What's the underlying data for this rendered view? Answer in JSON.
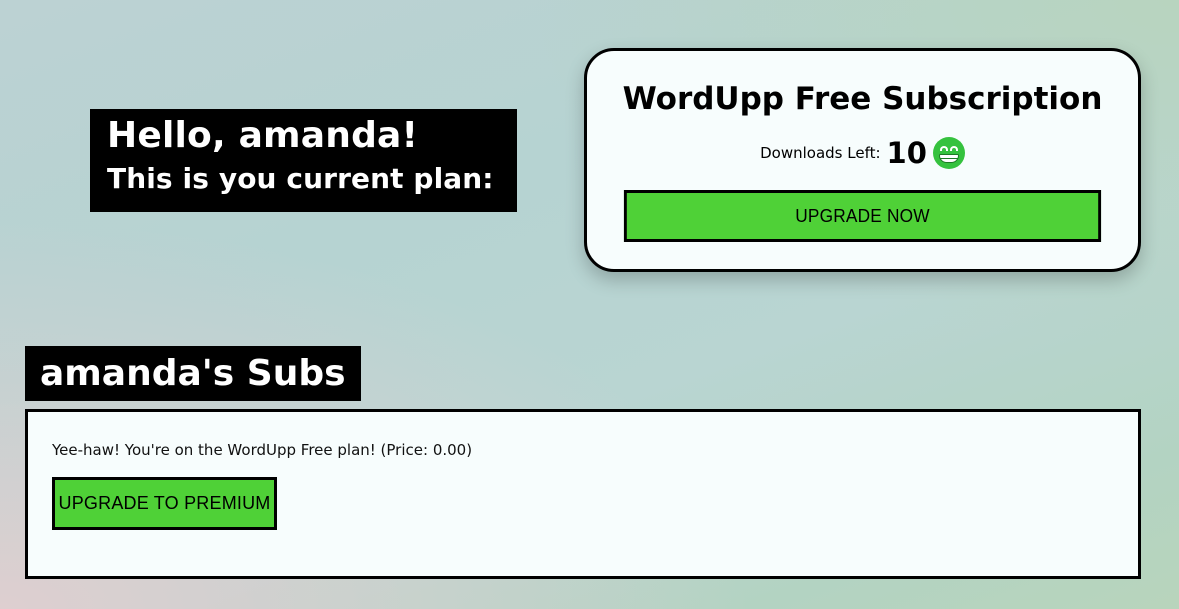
{
  "greeting": {
    "hello": "Hello, amanda!",
    "plan_line": "This is you current plan:"
  },
  "subscription_card": {
    "title": "WordUpp Free Subscription",
    "downloads_label": "Downloads Left:",
    "downloads_count": "10",
    "downloads_icon": "grinning-face-icon",
    "upgrade_button": "UPGRADE NOW"
  },
  "subs": {
    "heading": "amanda's Subs",
    "plan_text": "Yee-haw! You're on the WordUpp Free plan! (Price: 0.00)",
    "upgrade_button": "UPGRADE TO PREMIUM"
  },
  "colors": {
    "button_green": "#4fd137",
    "emoji_green": "#35c23e",
    "panel_background": "#f7fdfd",
    "heading_background": "#000000"
  }
}
